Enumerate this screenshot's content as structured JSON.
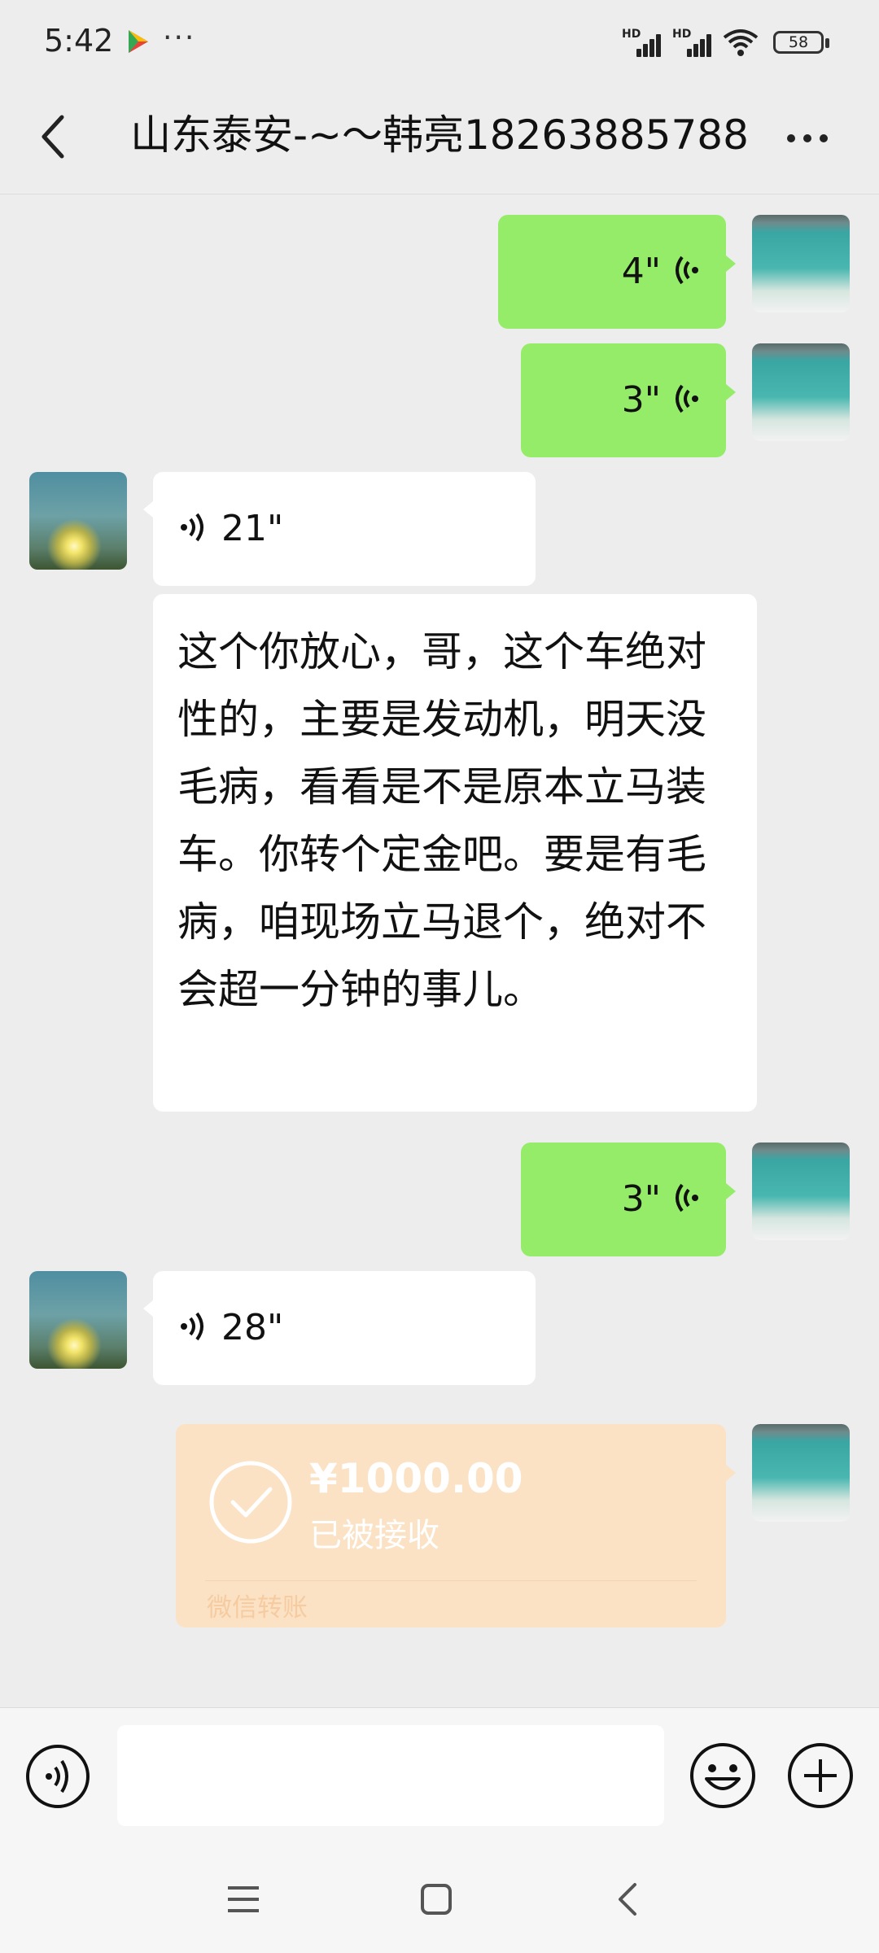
{
  "status_bar": {
    "time": "5:42",
    "more_dots": "···",
    "signal_1_label": "HD",
    "signal_2_label": "HD",
    "battery": "58"
  },
  "header": {
    "title": "山东泰安-~～韩亮18263885788"
  },
  "messages": [
    {
      "side": "right",
      "type": "voice",
      "duration": "4\""
    },
    {
      "side": "right",
      "type": "voice",
      "duration": "3\""
    },
    {
      "side": "left",
      "type": "voice",
      "duration": "21\""
    },
    {
      "side": "left",
      "type": "text",
      "text": "这个你放心，哥，这个车绝对性的，主要是发动机，明天没毛病，看看是不是原本立马装车。你转个定金吧。要是有毛病，咱现场立马退个，绝对不会超一分钟的事儿。"
    },
    {
      "side": "right",
      "type": "voice",
      "duration": "3\""
    },
    {
      "side": "left",
      "type": "voice",
      "duration": "28\""
    },
    {
      "side": "right",
      "type": "transfer",
      "amount": "¥1000.00",
      "status": "已被接收",
      "label": "微信转账"
    }
  ],
  "input": {
    "placeholder": ""
  },
  "colors": {
    "background": "#ededed",
    "outgoing_bubble": "#95ec69",
    "incoming_bubble": "#ffffff",
    "transfer_card": "#fbe2c5"
  },
  "icons": [
    "back-icon",
    "more-icon",
    "voice-wave-icon",
    "voice-toggle-icon",
    "emoji-icon",
    "plus-icon",
    "nav-menu-icon",
    "nav-home-icon",
    "nav-back-icon"
  ]
}
